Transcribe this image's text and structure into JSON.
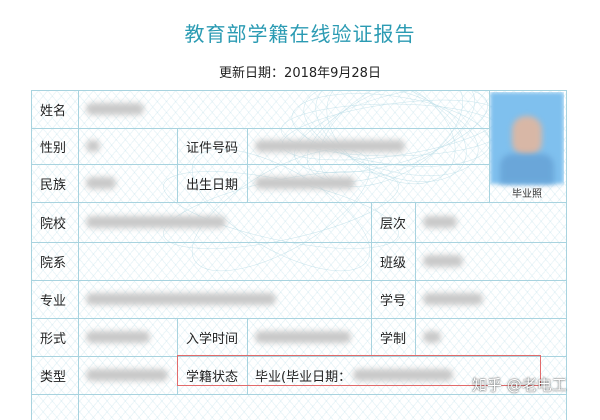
{
  "header": {
    "title": "教育部学籍在线验证报告",
    "update_date": "更新日期：2018年9月28日"
  },
  "table": {
    "name_label": "姓名",
    "gender_label": "性别",
    "id_label": "证件号码",
    "ethnicity_label": "民族",
    "birth_label": "出生日期",
    "school_label": "院校",
    "level_label": "层次",
    "department_label": "院系",
    "class_label": "班级",
    "major_label": "专业",
    "student_no_label": "学号",
    "form_label": "形式",
    "enroll_time_label": "入学时间",
    "schooling_label": "学制",
    "type_label": "类型",
    "status_label": "学籍状态",
    "status_value": "毕业(毕业日期："
  },
  "photo": {
    "caption": "毕业照"
  },
  "watermark": "知乎 @老电工",
  "colors": {
    "title": "#2b9bb3",
    "grid": "#a8d3df",
    "highlight": "#e26b6b"
  }
}
